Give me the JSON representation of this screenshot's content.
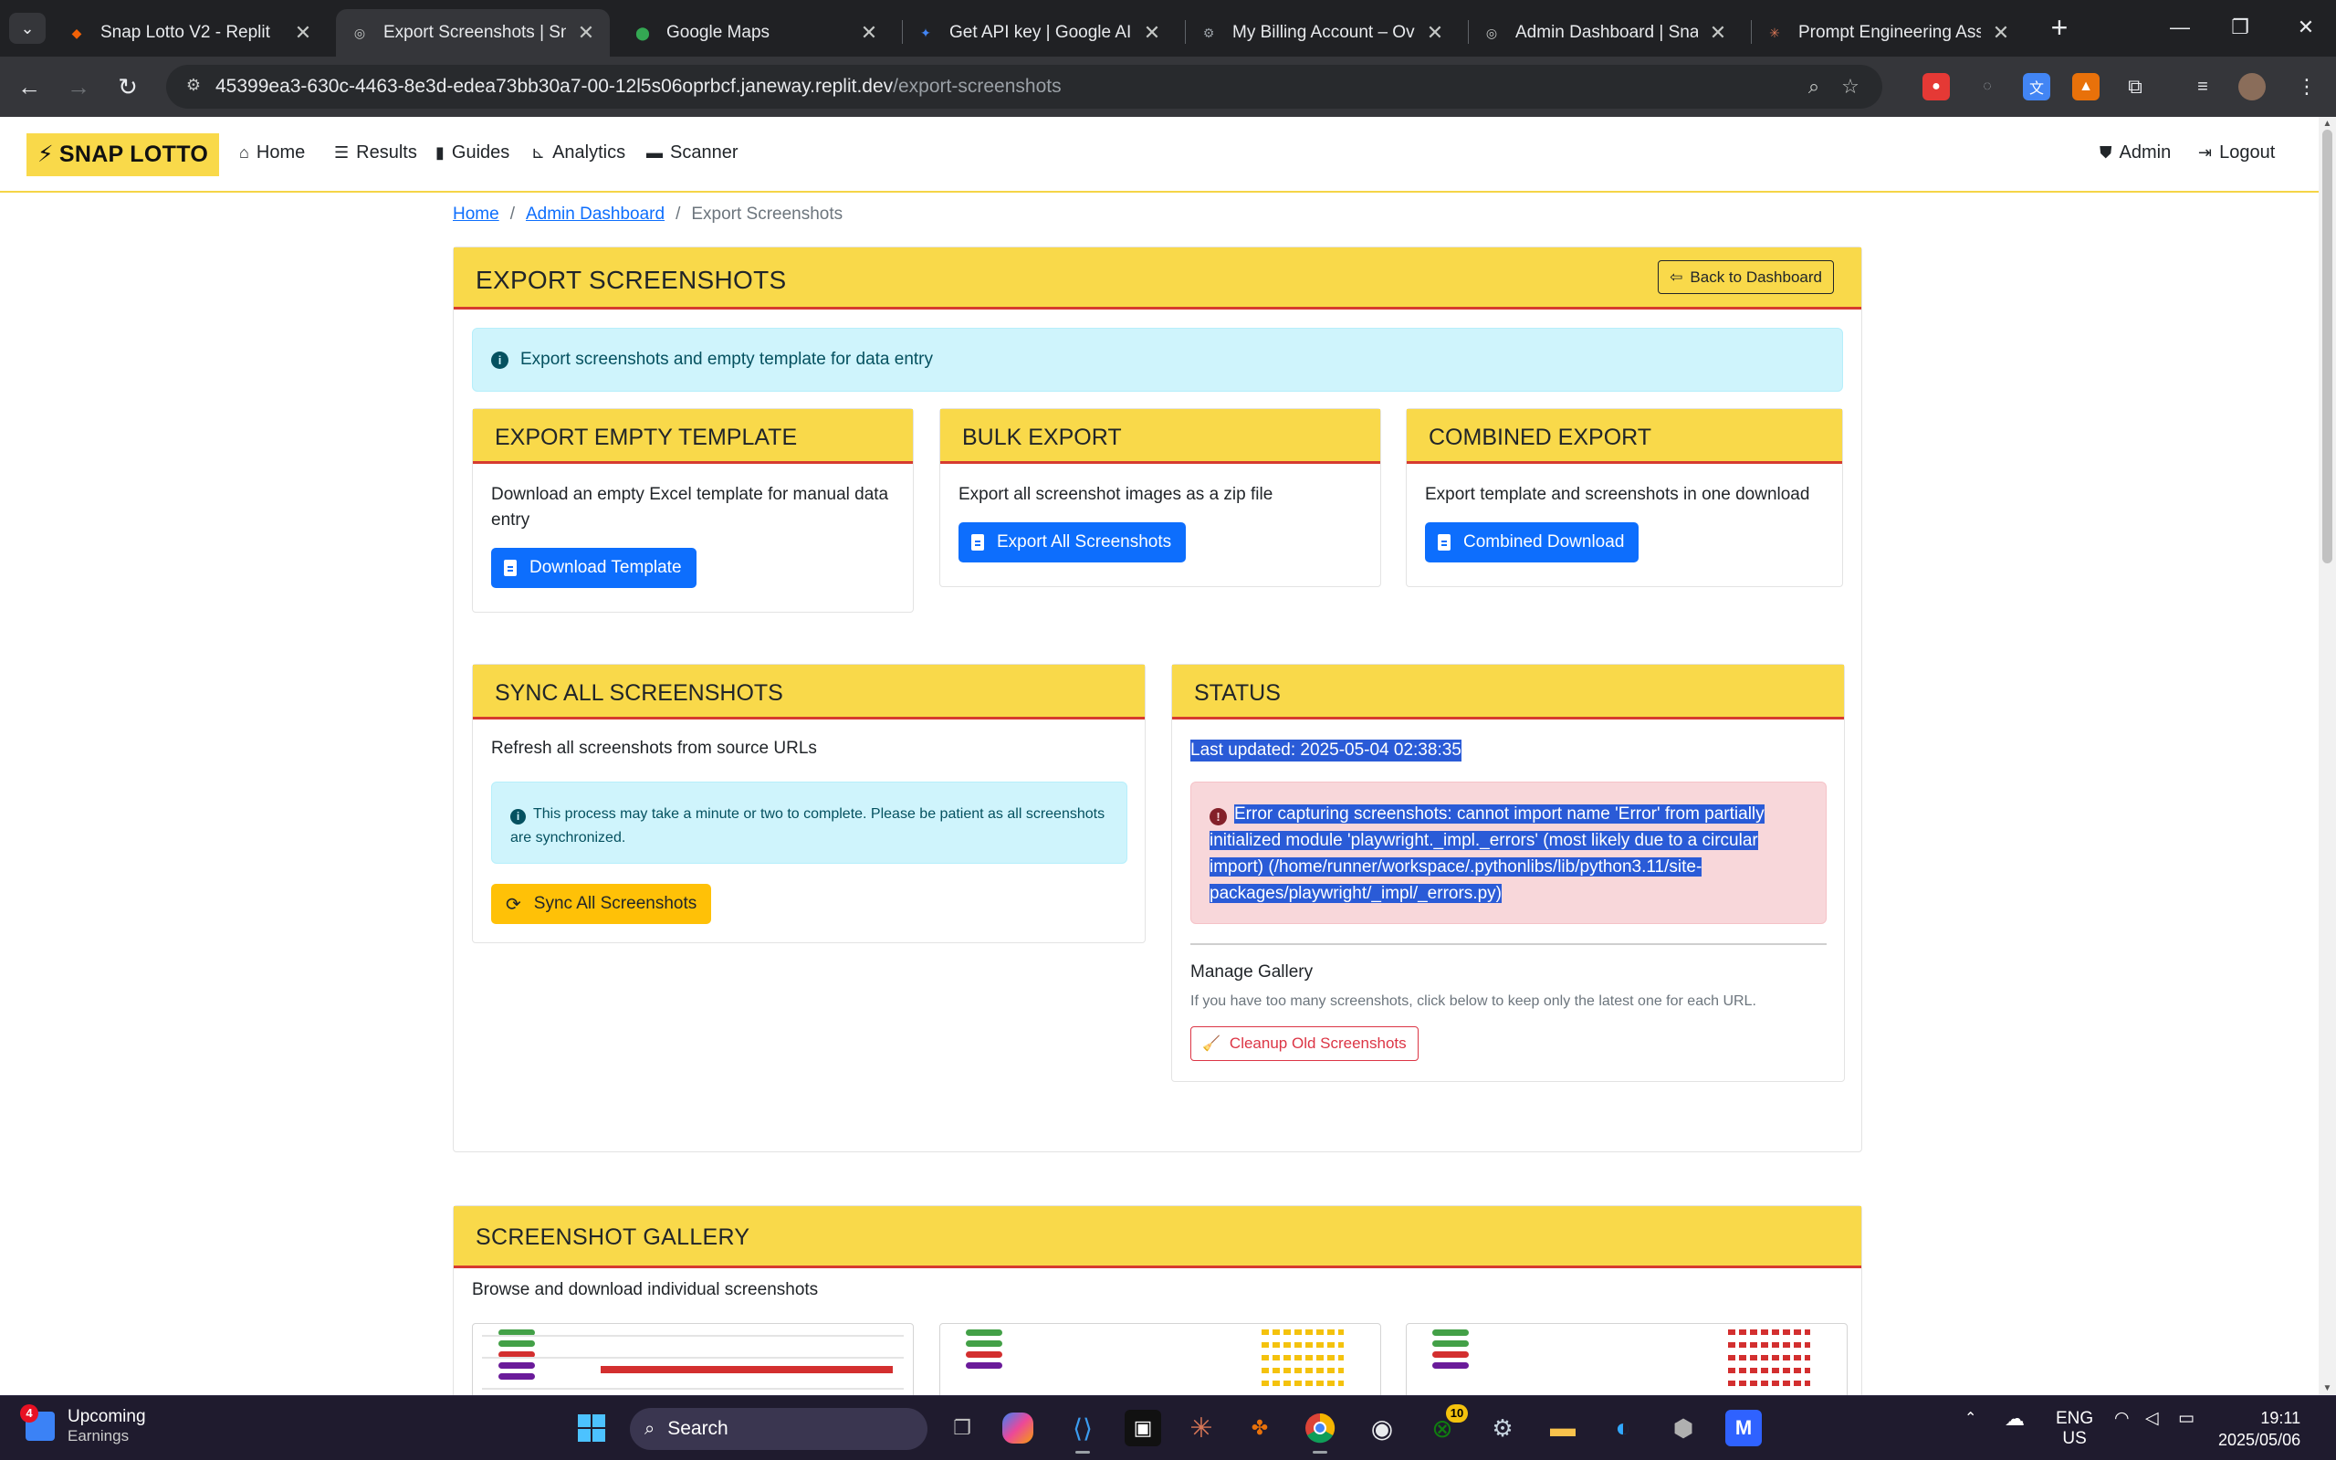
{
  "browser": {
    "tabs": [
      {
        "title": "Snap Lotto V2 - Replit",
        "favicon": "replit-icon",
        "color": "#f26207"
      },
      {
        "title": "Export Screenshots | Snap",
        "favicon": "globe-icon",
        "color": "#9aa0a6"
      },
      {
        "title": "Google Maps",
        "favicon": "maps-pin-icon",
        "color": "#34a853"
      },
      {
        "title": "Get API key | Google AI St",
        "favicon": "ai-studio-icon",
        "color": "#4285f4"
      },
      {
        "title": "My Billing Account – Over",
        "favicon": "billing-gear-icon",
        "color": "#9aa0a6"
      },
      {
        "title": "Admin Dashboard | Snap",
        "favicon": "globe-icon",
        "color": "#9aa0a6"
      },
      {
        "title": "Prompt Engineering Assis",
        "favicon": "claude-icon",
        "color": "#d97757"
      }
    ],
    "url_host": "45399ea3-630c-4463-8e3d-edea73bb30a7-00-12l5s06oprbcf.janeway.replit.dev",
    "url_path": "/export-screenshots"
  },
  "navbar": {
    "brand": "SNAP LOTTO",
    "links": [
      {
        "label": "Home",
        "icon": "home-icon"
      },
      {
        "label": "Results",
        "icon": "list-icon"
      },
      {
        "label": "Guides",
        "icon": "book-icon"
      },
      {
        "label": "Analytics",
        "icon": "chart-icon"
      },
      {
        "label": "Scanner",
        "icon": "scanner-icon"
      }
    ],
    "admin": "Admin",
    "logout": "Logout"
  },
  "breadcrumb": {
    "home": "Home",
    "admin": "Admin Dashboard",
    "current": "Export Screenshots"
  },
  "page": {
    "title": "EXPORT SCREENSHOTS",
    "back_button": "Back to Dashboard",
    "info": "Export screenshots and empty template for data entry"
  },
  "cards": {
    "template": {
      "title": "EXPORT EMPTY TEMPLATE",
      "text": "Download an empty Excel template for manual data entry",
      "button": "Download Template"
    },
    "bulk": {
      "title": "BULK EXPORT",
      "text": "Export all screenshot images as a zip file",
      "button": "Export All Screenshots"
    },
    "combined": {
      "title": "COMBINED EXPORT",
      "text": "Export template and screenshots in one download",
      "button": "Combined Download"
    },
    "sync": {
      "title": "SYNC ALL SCREENSHOTS",
      "text": "Refresh all screenshots from source URLs",
      "note": "This process may take a minute or two to complete. Please be patient as all screenshots are synchronized.",
      "button": "Sync All Screenshots"
    },
    "status": {
      "title": "STATUS",
      "last_updated": "Last updated: 2025-05-04 02:38:35",
      "error": "Error capturing screenshots: cannot import name 'Error' from partially initialized module 'playwright._impl._errors' (most likely due to a circular import) (/home/runner/workspace/.pythonlibs/lib/python3.11/site-packages/playwright/_impl/_errors.py)",
      "manage_title": "Manage Gallery",
      "manage_text": "If you have too many screenshots, click below to keep only the latest one for each URL.",
      "cleanup_button": "Cleanup Old Screenshots"
    }
  },
  "gallery": {
    "title": "SCREENSHOT GALLERY",
    "text": "Browse and download individual screenshots"
  },
  "taskbar": {
    "weather_badge": "4",
    "weather_l1": "Upcoming",
    "weather_l2": "Earnings",
    "search": "Search",
    "xbox_badge": "10",
    "lang_l1": "ENG",
    "lang_l2": "US",
    "time": "19:11",
    "date": "2025/05/06"
  },
  "colors": {
    "brand_yellow": "#f9d94a",
    "header_underline": "#d63b2f",
    "primary": "#0d6efd",
    "warning": "#ffc107",
    "danger": "#dc3545",
    "selection": "#2a5bd7"
  }
}
